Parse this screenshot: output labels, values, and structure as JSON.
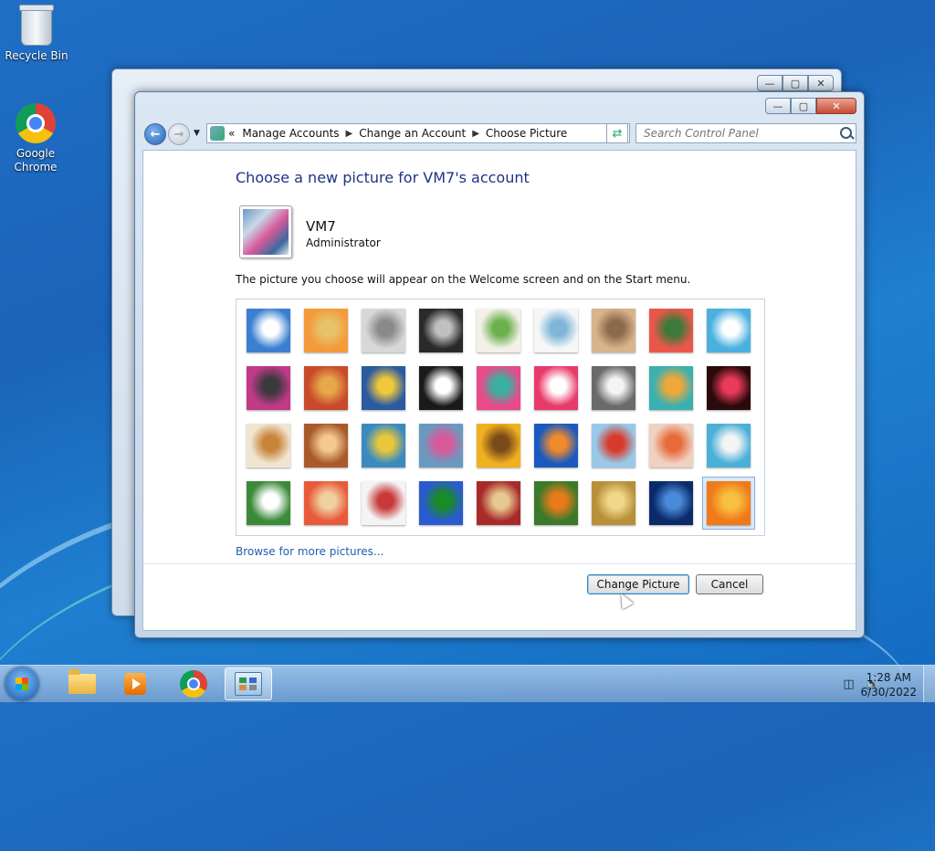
{
  "desktop": {
    "icons": [
      {
        "label": "Recycle Bin"
      },
      {
        "label": "Google Chrome"
      }
    ]
  },
  "window": {
    "controls": {
      "minimize": "—",
      "maximize": "▢",
      "close": "✕"
    },
    "address": {
      "crumbs": [
        "Manage Accounts",
        "Change an Account",
        "Choose Picture"
      ],
      "overflow": "«"
    },
    "search": {
      "placeholder": "Search Control Panel"
    },
    "heading": "Choose a new picture for VM7's account",
    "account": {
      "name": "VM7",
      "role": "Administrator"
    },
    "description": "The picture you choose will appear on the Welcome screen and on the Start menu.",
    "pictures": [
      {
        "name": "roller-coaster",
        "colors": [
          "#3a7fd0",
          "#ffffff"
        ]
      },
      {
        "name": "starfish",
        "colors": [
          "#f39b3a",
          "#e6c36a"
        ]
      },
      {
        "name": "robot-toy",
        "colors": [
          "#d8d8d8",
          "#8a8a8a"
        ]
      },
      {
        "name": "turntable",
        "colors": [
          "#2a2a2a",
          "#c0c0c0"
        ]
      },
      {
        "name": "lucky-cat",
        "colors": [
          "#f4f0e8",
          "#6ab04c"
        ]
      },
      {
        "name": "gyroscope",
        "colors": [
          "#f4f6f8",
          "#7fb5d8"
        ]
      },
      {
        "name": "kitten",
        "colors": [
          "#d8b48a",
          "#8a6a4a"
        ]
      },
      {
        "name": "flower",
        "colors": [
          "#e8584a",
          "#3a7a3a"
        ]
      },
      {
        "name": "pinwheel",
        "colors": [
          "#4ab0e0",
          "#ffffff"
        ]
      },
      {
        "name": "ball",
        "colors": [
          "#c03a8a",
          "#3a3a3a"
        ]
      },
      {
        "name": "fabric",
        "colors": [
          "#c84a2a",
          "#e8a84a"
        ]
      },
      {
        "name": "leaf",
        "colors": [
          "#2a5aa0",
          "#f0c83a"
        ]
      },
      {
        "name": "dog",
        "colors": [
          "#1a1a1a",
          "#ffffff"
        ]
      },
      {
        "name": "crayons",
        "colors": [
          "#e84a8a",
          "#3ab0a0"
        ]
      },
      {
        "name": "star-lantern",
        "colors": [
          "#e83a6a",
          "#ffffff"
        ]
      },
      {
        "name": "jacks",
        "colors": [
          "#6a6a6a",
          "#f4f4f4"
        ]
      },
      {
        "name": "stairs",
        "colors": [
          "#3ab0b0",
          "#f0a83a"
        ]
      },
      {
        "name": "origami-crane",
        "colors": [
          "#2a0a0a",
          "#e83a5a"
        ]
      },
      {
        "name": "guitar",
        "colors": [
          "#f0e6d0",
          "#c8843a"
        ]
      },
      {
        "name": "pomeranian",
        "colors": [
          "#a85a2a",
          "#f4c890"
        ]
      },
      {
        "name": "tin-robot",
        "colors": [
          "#3a8ac0",
          "#e8c83a"
        ]
      },
      {
        "name": "scarf",
        "colors": [
          "#6a9ac0",
          "#d85a9a"
        ]
      },
      {
        "name": "sunflower",
        "colors": [
          "#f0b020",
          "#7a4a1a"
        ]
      },
      {
        "name": "tropical-fish",
        "colors": [
          "#1a5ac0",
          "#f08a2a"
        ]
      },
      {
        "name": "hot-air-balloon",
        "colors": [
          "#9ac8e8",
          "#d83a2a"
        ]
      },
      {
        "name": "doll",
        "colors": [
          "#f0d0c0",
          "#e86a3a"
        ]
      },
      {
        "name": "sailboat",
        "colors": [
          "#4ab0d8",
          "#f4f4f4"
        ]
      },
      {
        "name": "soccer-ball",
        "colors": [
          "#3a8a3a",
          "#ffffff"
        ]
      },
      {
        "name": "textiles",
        "colors": [
          "#e85a3a",
          "#f0d0a0"
        ]
      },
      {
        "name": "marbles",
        "colors": [
          "#f4f4f4",
          "#c83a3a"
        ]
      },
      {
        "name": "window",
        "colors": [
          "#2a5ad0",
          "#1a8a2a"
        ]
      },
      {
        "name": "rug",
        "colors": [
          "#a82a2a",
          "#e8c890"
        ]
      },
      {
        "name": "butterfly",
        "colors": [
          "#3a7a2a",
          "#e87a1a"
        ]
      },
      {
        "name": "basket",
        "colors": [
          "#b8903a",
          "#f0d88a"
        ]
      },
      {
        "name": "lighthouse",
        "colors": [
          "#0a2a6a",
          "#4a8ad8"
        ]
      },
      {
        "name": "orange-flower",
        "colors": [
          "#f07a1a",
          "#f8c040"
        ]
      }
    ],
    "selected_index": 35,
    "browse_link": "Browse for more pictures...",
    "buttons": {
      "change": "Change Picture",
      "cancel": "Cancel"
    }
  },
  "taskbar": {
    "items": [
      {
        "name": "windows-explorer"
      },
      {
        "name": "windows-media-player"
      },
      {
        "name": "google-chrome"
      },
      {
        "name": "control-panel",
        "active": true
      }
    ],
    "time": "1:28 AM",
    "date": "6/30/2022"
  }
}
